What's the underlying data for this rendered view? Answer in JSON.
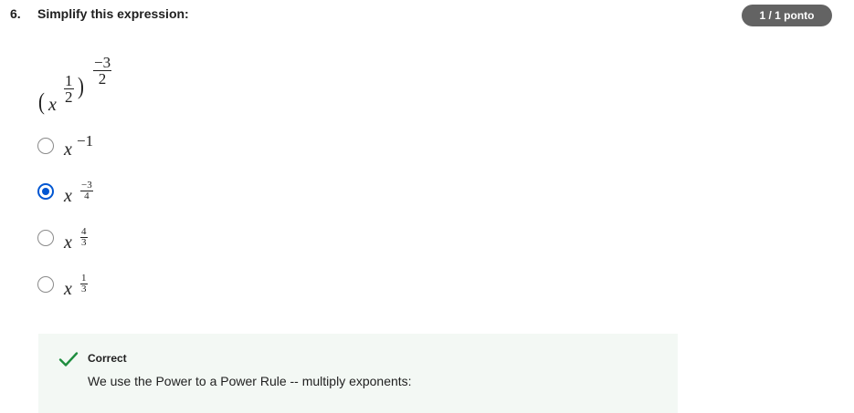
{
  "question": {
    "number": "6.",
    "title": "Simplify this expression:",
    "score": "1 / 1 ponto",
    "expression": {
      "base_var": "x",
      "inner_exp_num": "1",
      "inner_exp_den": "2",
      "outer_exp_num": "−3",
      "outer_exp_den": "2",
      "lparen": "(",
      "rparen": ")"
    }
  },
  "options": [
    {
      "var": "x",
      "exp": "−1",
      "selected": false
    },
    {
      "var": "x",
      "exp_num": "−3",
      "exp_den": "4",
      "selected": true
    },
    {
      "var": "x",
      "exp_num": "4",
      "exp_den": "3",
      "selected": false
    },
    {
      "var": "x",
      "exp_num": "1",
      "exp_den": "3",
      "selected": false
    }
  ],
  "feedback": {
    "status": "Correct",
    "text": "We use the Power to a Power Rule -- multiply exponents:",
    "icon": "check-icon",
    "accent_color": "#1e8d3e",
    "background_color": "#f3f8f4"
  },
  "colors": {
    "radio_selected": "#0056d2",
    "badge": "#636363"
  }
}
